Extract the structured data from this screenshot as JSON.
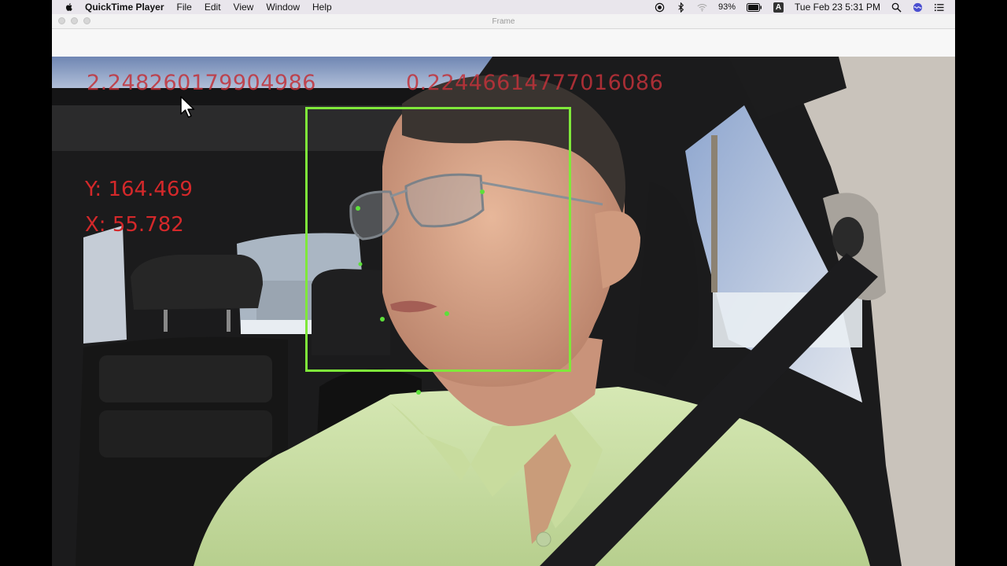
{
  "menubar": {
    "app_name": "QuickTime Player",
    "menus": [
      "File",
      "Edit",
      "View",
      "Window",
      "Help"
    ],
    "battery": "93%",
    "input_source": "A",
    "clock": "Tue Feb 23  5:31 PM"
  },
  "window": {
    "title": "Frame"
  },
  "overlay": {
    "value_left": "2.248260179904986",
    "value_right": "0.22446614777016086",
    "y_label": "Y:  164.469",
    "x_label": "X:  55.782"
  },
  "colors": {
    "detection_box": "#7fe83a",
    "landmark": "#5de03a",
    "overlay_text": "#d4282a"
  }
}
